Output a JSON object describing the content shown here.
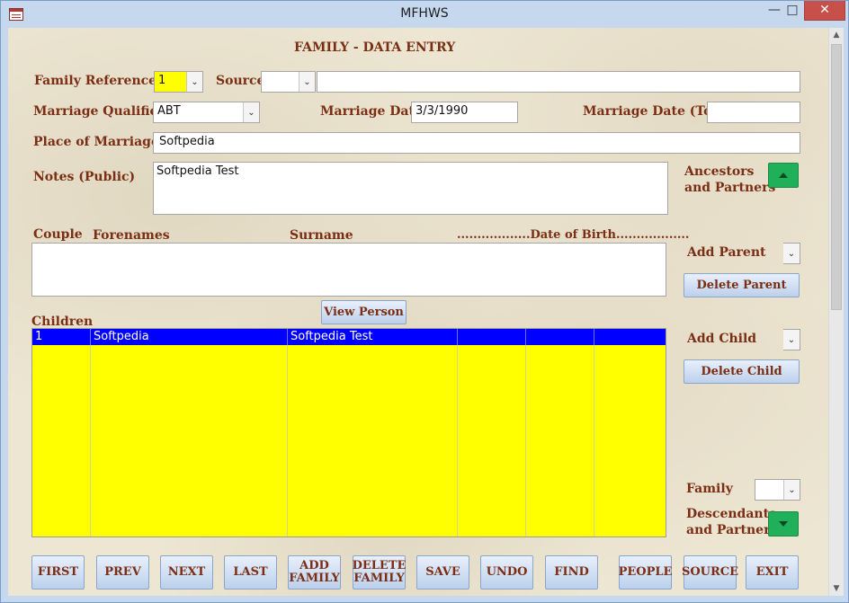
{
  "window": {
    "title": "MFHWS",
    "minimize_glyph": "—",
    "maximize_glyph": "□",
    "close_glyph": "✕"
  },
  "form": {
    "heading": "FAMILY - DATA ENTRY",
    "family_reference": {
      "label": "Family Reference",
      "value": "1"
    },
    "source": {
      "label": "Source",
      "value": "",
      "text_value": ""
    },
    "marriage_qualifier": {
      "label": "Marriage Qualifier",
      "value": "ABT"
    },
    "marriage_date": {
      "label": "Marriage Date",
      "value": "3/3/1990"
    },
    "marriage_date_to": {
      "label": "Marriage Date (To)",
      "value": ""
    },
    "place_of_marriage": {
      "label": "Place of Marriage",
      "value": "Softpedia"
    },
    "notes_public": {
      "label": "Notes (Public)",
      "value": "Softpedia Test"
    },
    "ancestors": {
      "label_line1": "Ancestors",
      "label_line2": "and Partners",
      "icon": "triangle-up-icon"
    },
    "couple_headers": {
      "couple": "Couple",
      "forenames": "Forenames",
      "surname": "Surname",
      "date_of_birth": "..................Date of Birth.................."
    },
    "add_parent_label": "Add Parent",
    "delete_parent_label": "Delete Parent",
    "view_person_label": "View Person",
    "children_label": "Children",
    "children_rows": [
      {
        "no": "1",
        "forenames": "Softpedia",
        "surname": "Softpedia Test"
      }
    ],
    "add_child_label": "Add Child",
    "delete_child_label": "Delete Child",
    "family_label": "Family",
    "descendants": {
      "label_line1": "Descendants",
      "label_line2": "and Partners",
      "icon": "triangle-down-icon"
    },
    "combo_arrow_glyph": "⌄"
  },
  "nav_buttons": [
    {
      "name": "first",
      "line1": "FIRST",
      "line2": ""
    },
    {
      "name": "prev",
      "line1": "PREV",
      "line2": ""
    },
    {
      "name": "next",
      "line1": "NEXT",
      "line2": ""
    },
    {
      "name": "last",
      "line1": "LAST",
      "line2": ""
    },
    {
      "name": "add-family",
      "line1": "ADD",
      "line2": "FAMILY"
    },
    {
      "name": "delete-family",
      "line1": "DELETE",
      "line2": "FAMILY"
    },
    {
      "name": "save",
      "line1": "SAVE",
      "line2": ""
    },
    {
      "name": "undo",
      "line1": "UNDO",
      "line2": ""
    },
    {
      "name": "find",
      "line1": "FIND",
      "line2": ""
    },
    {
      "name": "people",
      "line1": "PEOPLE",
      "line2": ""
    },
    {
      "name": "source",
      "line1": "SOURCE",
      "line2": ""
    },
    {
      "name": "exit",
      "line1": "EXIT",
      "line2": ""
    }
  ],
  "scrollbar": {
    "up_glyph": "▲",
    "down_glyph": "▼"
  },
  "colors": {
    "label": "#7a2e14",
    "grid_background": "#ffff00",
    "selected_row": "#0000ff",
    "green_button": "#21b05a",
    "close_button": "#c7504a"
  }
}
